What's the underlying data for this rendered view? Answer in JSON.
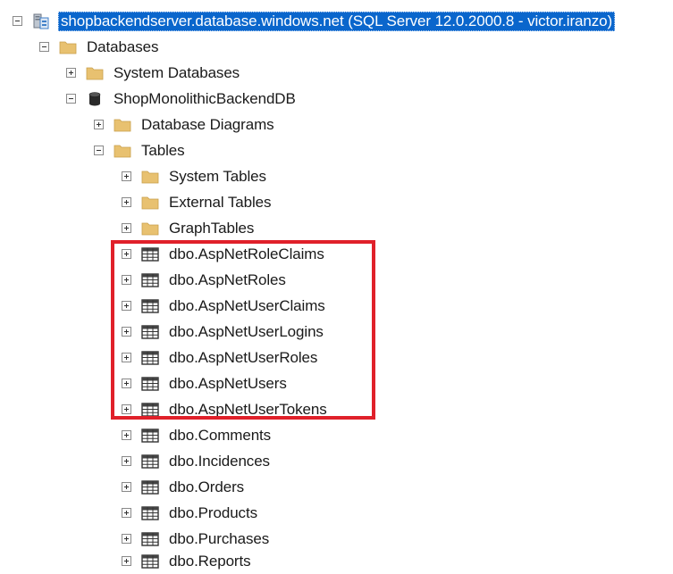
{
  "tree": {
    "server": {
      "label": "shopbackendserver.database.windows.net (SQL Server 12.0.2000.8 - victor.iranzo)",
      "icon": "server-icon",
      "expanded": true,
      "selected": true
    },
    "databases": {
      "label": "Databases",
      "icon": "folder-icon",
      "expanded": true
    },
    "system_databases": {
      "label": "System Databases",
      "icon": "folder-icon",
      "expanded": false
    },
    "database": {
      "label": "ShopMonolithicBackendDB",
      "icon": "database-icon",
      "expanded": true
    },
    "database_diagrams": {
      "label": "Database Diagrams",
      "icon": "folder-icon",
      "expanded": false
    },
    "tables": {
      "label": "Tables",
      "icon": "folder-icon",
      "expanded": true
    },
    "table_folders": [
      {
        "label": "System Tables",
        "icon": "folder-icon"
      },
      {
        "label": "External Tables",
        "icon": "folder-icon"
      },
      {
        "label": "GraphTables",
        "icon": "folder-icon"
      }
    ],
    "highlighted_tables": [
      {
        "label": "dbo.AspNetRoleClaims",
        "icon": "table-icon"
      },
      {
        "label": "dbo.AspNetRoles",
        "icon": "table-icon"
      },
      {
        "label": "dbo.AspNetUserClaims",
        "icon": "table-icon"
      },
      {
        "label": "dbo.AspNetUserLogins",
        "icon": "table-icon"
      },
      {
        "label": "dbo.AspNetUserRoles",
        "icon": "table-icon"
      },
      {
        "label": "dbo.AspNetUsers",
        "icon": "table-icon"
      },
      {
        "label": "dbo.AspNetUserTokens",
        "icon": "table-icon"
      }
    ],
    "other_tables": [
      {
        "label": "dbo.Comments",
        "icon": "table-icon"
      },
      {
        "label": "dbo.Incidences",
        "icon": "table-icon"
      },
      {
        "label": "dbo.Orders",
        "icon": "table-icon"
      },
      {
        "label": "dbo.Products",
        "icon": "table-icon"
      },
      {
        "label": "dbo.Purchases",
        "icon": "table-icon"
      },
      {
        "label": "dbo.Reports",
        "icon": "table-icon"
      }
    ]
  },
  "colors": {
    "selection": "#0a66cc",
    "highlight_border": "#e0202a",
    "folder": "#e8c170"
  }
}
